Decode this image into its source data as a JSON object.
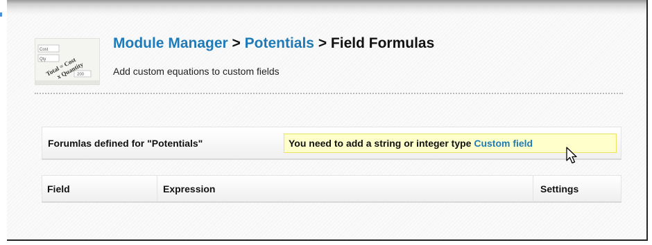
{
  "icon": {
    "name": "formula-icon",
    "lines": [
      "Cost",
      "Qty",
      "Total = Cost",
      "x Quantity",
      "200"
    ]
  },
  "header": {
    "breadcrumb_module_manager": "Module Manager",
    "separator1": " > ",
    "breadcrumb_potentials": "Potentials",
    "separator2": " > ",
    "page_title": "Field Formulas",
    "subtitle": "Add custom equations to custom fields"
  },
  "formulas": {
    "label": "Forumlas defined for \"Potentials\"",
    "warning_text": "You need to add a string or integer type ",
    "warning_link": "Custom field"
  },
  "table": {
    "columns": [
      "Field",
      "Expression",
      "Settings"
    ]
  },
  "colors": {
    "link": "#1f7ab8",
    "warning_bg": "#ffffcc",
    "warning_border": "#f0e060"
  }
}
